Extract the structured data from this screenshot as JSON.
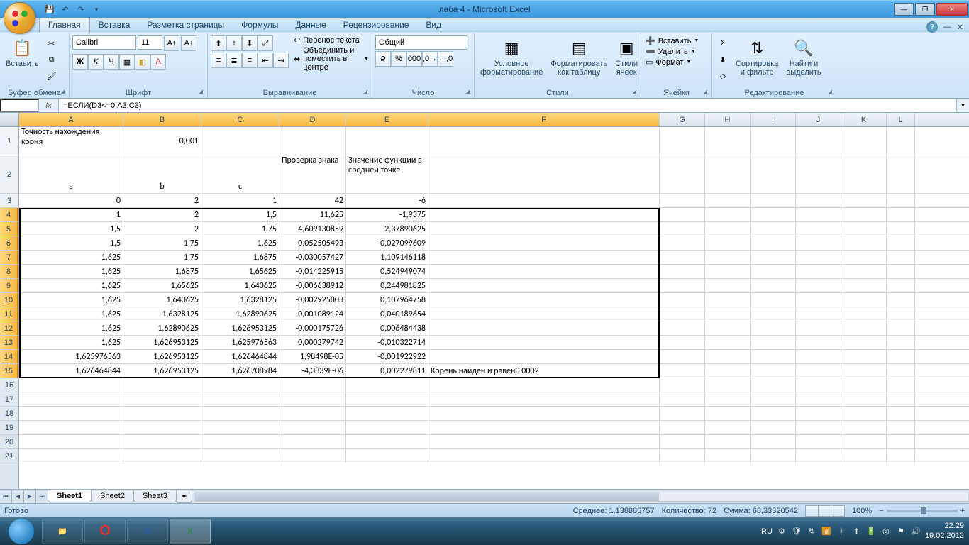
{
  "title": "лаба 4 - Microsoft Excel",
  "tabs": [
    "Главная",
    "Вставка",
    "Разметка страницы",
    "Формулы",
    "Данные",
    "Рецензирование",
    "Вид"
  ],
  "activeTab": 0,
  "ribbon": {
    "clipboard": {
      "paste": "Вставить",
      "label": "Буфер обмена"
    },
    "font": {
      "name": "Calibri",
      "size": "11",
      "label": "Шрифт"
    },
    "alignment": {
      "wrap": "Перенос текста",
      "merge": "Объединить и поместить в центре",
      "label": "Выравнивание"
    },
    "number": {
      "format": "Общий",
      "label": "Число"
    },
    "styles": {
      "cond": "Условное\nформатирование",
      "table": "Форматировать\nкак таблицу",
      "cell": "Стили\nячеек",
      "label": "Стили"
    },
    "cells": {
      "insert": "Вставить",
      "delete": "Удалить",
      "format": "Формат",
      "label": "Ячейки"
    },
    "editing": {
      "sort": "Сортировка\nи фильтр",
      "find": "Найти и\nвыделить",
      "label": "Редактирование"
    }
  },
  "nameBox": "",
  "formula": "=ЕСЛИ(D3<=0;A3;C3)",
  "columns": [
    "A",
    "B",
    "C",
    "D",
    "E",
    "F",
    "G",
    "H",
    "I",
    "J",
    "K",
    "L"
  ],
  "selectedRange": "A4:F15",
  "cells": {
    "r1": {
      "A": "Точность нахождения корня",
      "B": "0,001"
    },
    "r2": {
      "A": "a",
      "B": "b",
      "C": "c",
      "D": "Проверка знака",
      "E": "Значение функции в средней точке"
    },
    "r3": {
      "A": "0",
      "B": "2",
      "C": "1",
      "D": "42",
      "E": "-6"
    },
    "r4": {
      "A": "1",
      "B": "2",
      "C": "1,5",
      "D": "11,625",
      "E": "-1,9375"
    },
    "r5": {
      "A": "1,5",
      "B": "2",
      "C": "1,75",
      "D": "-4,609130859",
      "E": "2,37890625"
    },
    "r6": {
      "A": "1,5",
      "B": "1,75",
      "C": "1,625",
      "D": "0,052505493",
      "E": "-0,027099609"
    },
    "r7": {
      "A": "1,625",
      "B": "1,75",
      "C": "1,6875",
      "D": "-0,030057427",
      "E": "1,109146118"
    },
    "r8": {
      "A": "1,625",
      "B": "1,6875",
      "C": "1,65625",
      "D": "-0,014225915",
      "E": "0,524949074"
    },
    "r9": {
      "A": "1,625",
      "B": "1,65625",
      "C": "1,640625",
      "D": "-0,006638912",
      "E": "0,244981825"
    },
    "r10": {
      "A": "1,625",
      "B": "1,640625",
      "C": "1,6328125",
      "D": "-0,002925803",
      "E": "0,107964758"
    },
    "r11": {
      "A": "1,625",
      "B": "1,6328125",
      "C": "1,62890625",
      "D": "-0,001089124",
      "E": "0,040189654"
    },
    "r12": {
      "A": "1,625",
      "B": "1,62890625",
      "C": "1,626953125",
      "D": "-0,000175726",
      "E": "0,006484438"
    },
    "r13": {
      "A": "1,625",
      "B": "1,626953125",
      "C": "1,625976563",
      "D": "0,000279742",
      "E": "-0,010322714"
    },
    "r14": {
      "A": "1,625976563",
      "B": "1,626953125",
      "C": "1,626464844",
      "D": "1,98498E-05",
      "E": "-0,001922922"
    },
    "r15": {
      "A": "1,626464844",
      "B": "1,626953125",
      "C": "1,626708984",
      "D": "-4,3839E-06",
      "E": "0,002279811",
      "F": "Корень найден и равен0 0002"
    }
  },
  "sheets": [
    "Sheet1",
    "Sheet2",
    "Sheet3"
  ],
  "activeSheet": 0,
  "status": {
    "ready": "Готово",
    "avg": "Среднее: 1,138886757",
    "count": "Количество: 72",
    "sum": "Сумма: 68,33320542",
    "zoom": "100%"
  },
  "taskbar": {
    "lang": "RU",
    "time": "22:29",
    "date": "19.02.2012"
  }
}
